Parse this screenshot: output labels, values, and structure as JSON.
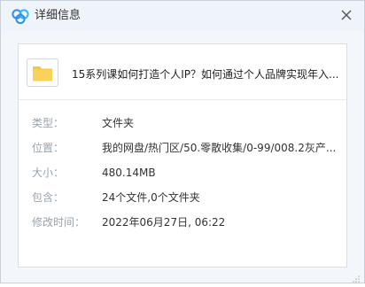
{
  "window": {
    "title": "详细信息",
    "app_logo_icon": "baidu-netdisk-logo-icon",
    "close_icon": "close-icon"
  },
  "file": {
    "icon": "folder-icon",
    "name": "15系列课如何打造个人IP？如何通过个人品牌实现年入..."
  },
  "details": [
    {
      "label": "类型：",
      "value": "文件夹"
    },
    {
      "label": "位置：",
      "value": "我的网盘/热门区/50.零散收集/0-99/008.2灰产..."
    },
    {
      "label": "大小：",
      "value": "480.14MB"
    },
    {
      "label": "包含：",
      "value": "24个文件,0个文件夹"
    },
    {
      "label": "修改时间：",
      "value": "2022年06月27日, 06:22"
    }
  ],
  "colors": {
    "folder": "#f8c73d",
    "logo_blue": "#2f8df5",
    "label": "#9aa3ad"
  }
}
